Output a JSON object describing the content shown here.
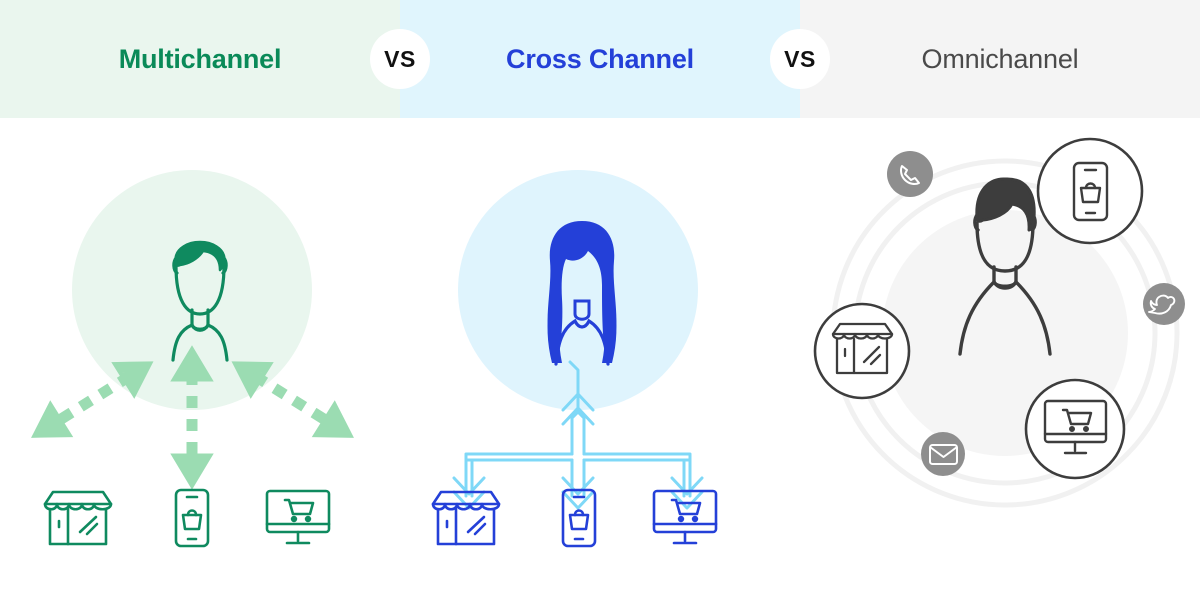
{
  "header": {
    "panels": [
      {
        "id": "multichannel",
        "label": "Multichannel",
        "bg": "#eaf6ee",
        "text_color": "#0a8a58"
      },
      {
        "id": "crosschannel",
        "label": "Cross Channel",
        "bg": "#e0f5fd",
        "text_color": "#2440d8"
      },
      {
        "id": "omnichannel",
        "label": "Omnichannel",
        "bg": "#f4f4f4",
        "text_color": "#4a4a4a"
      }
    ],
    "separators": [
      {
        "id": "vs-one",
        "label": "VS"
      },
      {
        "id": "vs-two",
        "label": "VS"
      }
    ]
  },
  "columns": {
    "multichannel": {
      "accent_color": "#0f8a5f",
      "disc_color": "#e9f6ee",
      "arrow_color": "#9bdcb2",
      "arrow_style": "dashed-double-headed",
      "person": "female-customer-avatar",
      "channels": [
        {
          "icon": "store-icon",
          "name": "physical-store"
        },
        {
          "icon": "mobile-shopping-icon",
          "name": "mobile-app"
        },
        {
          "icon": "desktop-cart-icon",
          "name": "online-store"
        }
      ]
    },
    "crosschannel": {
      "accent_color": "#2440d8",
      "disc_color": "#dff4fd",
      "arrow_color": "#7fd8f7",
      "arrow_style": "connected-outline-tree",
      "person": "female-customer-avatar",
      "channels": [
        {
          "icon": "store-icon",
          "name": "physical-store"
        },
        {
          "icon": "mobile-shopping-icon",
          "name": "mobile-app"
        },
        {
          "icon": "desktop-cart-icon",
          "name": "online-store"
        }
      ]
    },
    "omnichannel": {
      "accent_color": "#3d3d3d",
      "ring_color": "#f0f0f0",
      "disc_color": "#f5f5f5",
      "badge_color": "#8e8e8e",
      "person": "male-customer-avatar",
      "outlined_channels": [
        {
          "icon": "mobile-shopping-icon",
          "name": "mobile-app",
          "position": "top-right"
        },
        {
          "icon": "store-icon",
          "name": "physical-store",
          "position": "left"
        },
        {
          "icon": "desktop-cart-icon",
          "name": "online-store",
          "position": "bottom-right"
        }
      ],
      "badge_channels": [
        {
          "icon": "phone-icon",
          "name": "call-center",
          "position": "top-left"
        },
        {
          "icon": "twitter-icon",
          "name": "social-media",
          "position": "right"
        },
        {
          "icon": "email-icon",
          "name": "email",
          "position": "bottom-left"
        }
      ]
    }
  }
}
